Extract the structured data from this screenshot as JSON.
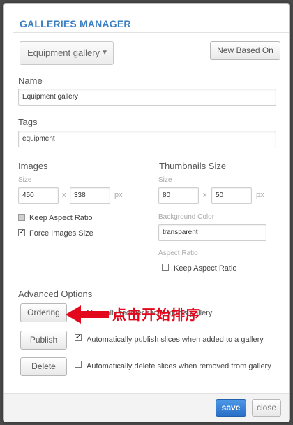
{
  "dialog": {
    "title": "GALLERIES MANAGER",
    "gallery_select": "Equipment gallery",
    "new_based_on": "New Based On"
  },
  "name": {
    "label": "Name",
    "value": "Equipment gallery"
  },
  "tags": {
    "label": "Tags",
    "value": "equipment"
  },
  "images": {
    "label": "Images",
    "size_label": "Size",
    "width": "450",
    "height": "338",
    "x_sep": "x",
    "unit": "px",
    "keep_aspect_label": "Keep Aspect Ratio",
    "keep_aspect_checked": false,
    "force_size_label": "Force Images Size",
    "force_size_checked": true
  },
  "thumbnails": {
    "label": "Thumbnails Size",
    "size_label": "Size",
    "width": "80",
    "height": "50",
    "x_sep": "x",
    "unit": "px",
    "bg_label": "Background Color",
    "bg_value": "transparent",
    "aspect_label": "Aspect Ratio",
    "keep_aspect_label": "Keep Aspect Ratio",
    "keep_aspect_checked": false
  },
  "advanced": {
    "label": "Advanced Options",
    "ordering_button": "Ordering",
    "ordering_text": "Manually reorder slices in this gallery",
    "publish_button": "Publish",
    "publish_text": "Automatically publish slices when added to a gallery",
    "publish_checked": true,
    "delete_button": "Delete",
    "delete_text": "Automatically delete slices when removed from gallery",
    "delete_checked": false
  },
  "annotation": {
    "text": "点击开始排序",
    "color": "#e4081c"
  },
  "footer": {
    "save": "save",
    "close": "close"
  },
  "colors": {
    "title": "#3a7fc1",
    "save_button": "#2f7fd8"
  }
}
